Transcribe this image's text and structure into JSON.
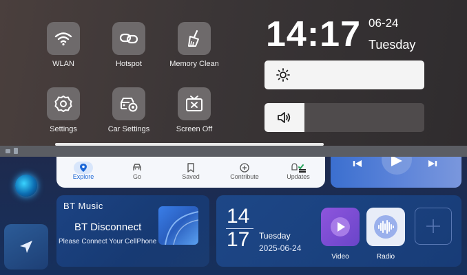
{
  "quick_settings": [
    {
      "id": "wlan",
      "label": "WLAN",
      "icon": "wifi-icon"
    },
    {
      "id": "hotspot",
      "label": "Hotspot",
      "icon": "link-icon"
    },
    {
      "id": "memory-clean",
      "label": "Memory Clean",
      "icon": "broom-icon"
    },
    {
      "id": "settings",
      "label": "Settings",
      "icon": "gear-icon"
    },
    {
      "id": "car-settings",
      "label": "Car Settings",
      "icon": "car-gear-icon"
    },
    {
      "id": "screen-off",
      "label": "Screen Off",
      "icon": "screen-off-icon"
    }
  ],
  "clock": {
    "time": "14:17",
    "date": "06-24",
    "weekday": "Tuesday"
  },
  "brightness": {
    "level": 1.0,
    "icon": "sun-icon"
  },
  "volume": {
    "level": 0.25,
    "icon": "speaker-icon"
  },
  "map_nav": [
    {
      "label": "Explore",
      "icon": "location-pin-icon",
      "active": true
    },
    {
      "label": "Go",
      "icon": "car-icon",
      "active": false
    },
    {
      "label": "Saved",
      "icon": "bookmark-icon",
      "active": false
    },
    {
      "label": "Contribute",
      "icon": "plus-circle-icon",
      "active": false
    },
    {
      "label": "Updates",
      "icon": "bell-icon",
      "active": false
    }
  ],
  "bt_music": {
    "title": "BT Music",
    "status": "BT Disconnect",
    "prompt": "Please Connect Your CellPhone"
  },
  "date_card": {
    "day_top": "14",
    "day_bottom": "17",
    "weekday": "Tuesday",
    "full_date": "2025-06-24"
  },
  "apps": [
    {
      "label": "Video",
      "icon": "play-icon",
      "color": "#8a4fd9"
    },
    {
      "label": "Radio",
      "icon": "radio-wave-icon",
      "color": "#9fb6f0"
    }
  ],
  "colors": {
    "accent": "#1a66d6",
    "card": "#1c4383"
  }
}
